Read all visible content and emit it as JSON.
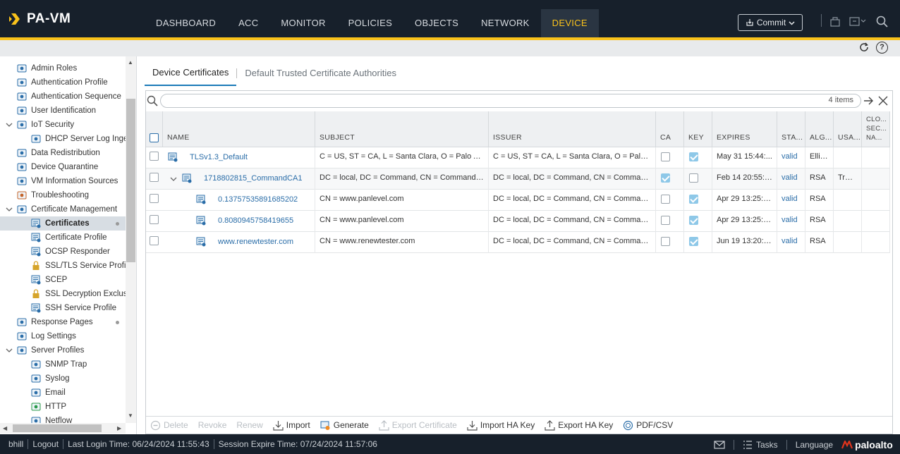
{
  "app": {
    "brand": "PA-VM",
    "nav": [
      "DASHBOARD",
      "ACC",
      "MONITOR",
      "POLICIES",
      "OBJECTS",
      "NETWORK",
      "DEVICE"
    ],
    "active_nav": "DEVICE",
    "commit_label": "Commit"
  },
  "sidebar": {
    "items": [
      {
        "label": "Admin Roles",
        "icon": "admin-roles-icon"
      },
      {
        "label": "Authentication Profile",
        "icon": "auth-profile-icon"
      },
      {
        "label": "Authentication Sequence",
        "icon": "auth-sequence-icon"
      },
      {
        "label": "User Identification",
        "icon": "user-id-icon"
      },
      {
        "label": "IoT Security",
        "icon": "iot-icon"
      },
      {
        "label": "DHCP Server Log Ingestion",
        "icon": "dhcp-icon"
      },
      {
        "label": "Data Redistribution",
        "icon": "redistribution-icon"
      },
      {
        "label": "Device Quarantine",
        "icon": "quarantine-icon"
      },
      {
        "label": "VM Information Sources",
        "icon": "vm-icon"
      },
      {
        "label": "Troubleshooting",
        "icon": "wrench-icon"
      },
      {
        "label": "Certificate Management",
        "icon": "cert-mgmt-icon"
      },
      {
        "label": "Certificates",
        "icon": "certificate-icon"
      },
      {
        "label": "Certificate Profile",
        "icon": "certificate-icon"
      },
      {
        "label": "OCSP Responder",
        "icon": "certificate-icon"
      },
      {
        "label": "SSL/TLS Service Profile",
        "icon": "lock-icon"
      },
      {
        "label": "SCEP",
        "icon": "certificate-icon"
      },
      {
        "label": "SSL Decryption Exclusion",
        "icon": "lock-icon"
      },
      {
        "label": "SSH Service Profile",
        "icon": "certificate-icon"
      },
      {
        "label": "Response Pages",
        "icon": "pages-icon"
      },
      {
        "label": "Log Settings",
        "icon": "log-icon"
      },
      {
        "label": "Server Profiles",
        "icon": "server-icon"
      },
      {
        "label": "SNMP Trap",
        "icon": "snmp-icon"
      },
      {
        "label": "Syslog",
        "icon": "syslog-icon"
      },
      {
        "label": "Email",
        "icon": "email-icon"
      },
      {
        "label": "HTTP",
        "icon": "http-icon"
      },
      {
        "label": "Netflow",
        "icon": "netflow-icon"
      }
    ]
  },
  "main": {
    "tabs": [
      "Device Certificates",
      "Default Trusted Certificate Authorities"
    ],
    "active_tab": "Device Certificates",
    "search": {
      "value": "",
      "placeholder": ""
    },
    "item_count": "4 items",
    "columns": [
      "NAME",
      "SUBJECT",
      "ISSUER",
      "CA",
      "KEY",
      "EXPIRES",
      "STA...",
      "ALG...",
      "USA...",
      "CLO... SEC... NA..."
    ],
    "rows": [
      {
        "name": "TLSv1.3_Default",
        "subject": "C = US, ST = CA, L = Santa Clara, O = Palo Alto ...",
        "issuer": "C = US, ST = CA, L = Santa Clara, O = Palo Alt...",
        "ca": false,
        "key": true,
        "expires": "May 31 15:44:...",
        "status": "valid",
        "algorithm": "Ellip...",
        "usage": ""
      },
      {
        "name": "1718802815_CommandCA1",
        "subject": "DC = local, DC = Command, CN = CommandCA1",
        "issuer": "DC = local, DC = Command, CN = Command...",
        "ca": true,
        "key": false,
        "expires": "Feb 14 20:55:4...",
        "status": "valid",
        "algorithm": "RSA",
        "usage": "Trus..."
      },
      {
        "name": "0.13757535891685202",
        "subject": "CN = www.panlevel.com",
        "issuer": "DC = local, DC = Command, CN = Command...",
        "ca": false,
        "key": true,
        "expires": "Apr 29 13:25:0...",
        "status": "valid",
        "algorithm": "RSA",
        "usage": ""
      },
      {
        "name": "0.8080945758419655",
        "subject": "CN = www.panlevel.com",
        "issuer": "DC = local, DC = Command, CN = Command...",
        "ca": false,
        "key": true,
        "expires": "Apr 29 13:25:0...",
        "status": "valid",
        "algorithm": "RSA",
        "usage": ""
      },
      {
        "name": "www.renewtester.com",
        "subject": "CN = www.renewtester.com",
        "issuer": "DC = local, DC = Command, CN = Command...",
        "ca": false,
        "key": true,
        "expires": "Jun 19 13:20:2...",
        "status": "valid",
        "algorithm": "RSA",
        "usage": ""
      }
    ]
  },
  "toolbar": {
    "delete": "Delete",
    "revoke": "Revoke",
    "renew": "Renew",
    "import": "Import",
    "generate": "Generate",
    "export_certificate": "Export Certificate",
    "import_ha_key": "Import HA Key",
    "export_ha_key": "Export HA Key",
    "pdf_csv": "PDF/CSV"
  },
  "status": {
    "user": "bhill",
    "logout": "Logout",
    "last_login": "Last Login Time: 06/24/2024 11:55:43",
    "session_expire": "Session Expire Time: 07/24/2024 11:57:06",
    "tasks": "Tasks",
    "language": "Language",
    "vendor": "paloalto"
  },
  "colors": {
    "accent": "#f9c21b",
    "link": "#2a6da8",
    "topbar": "#17202b"
  }
}
